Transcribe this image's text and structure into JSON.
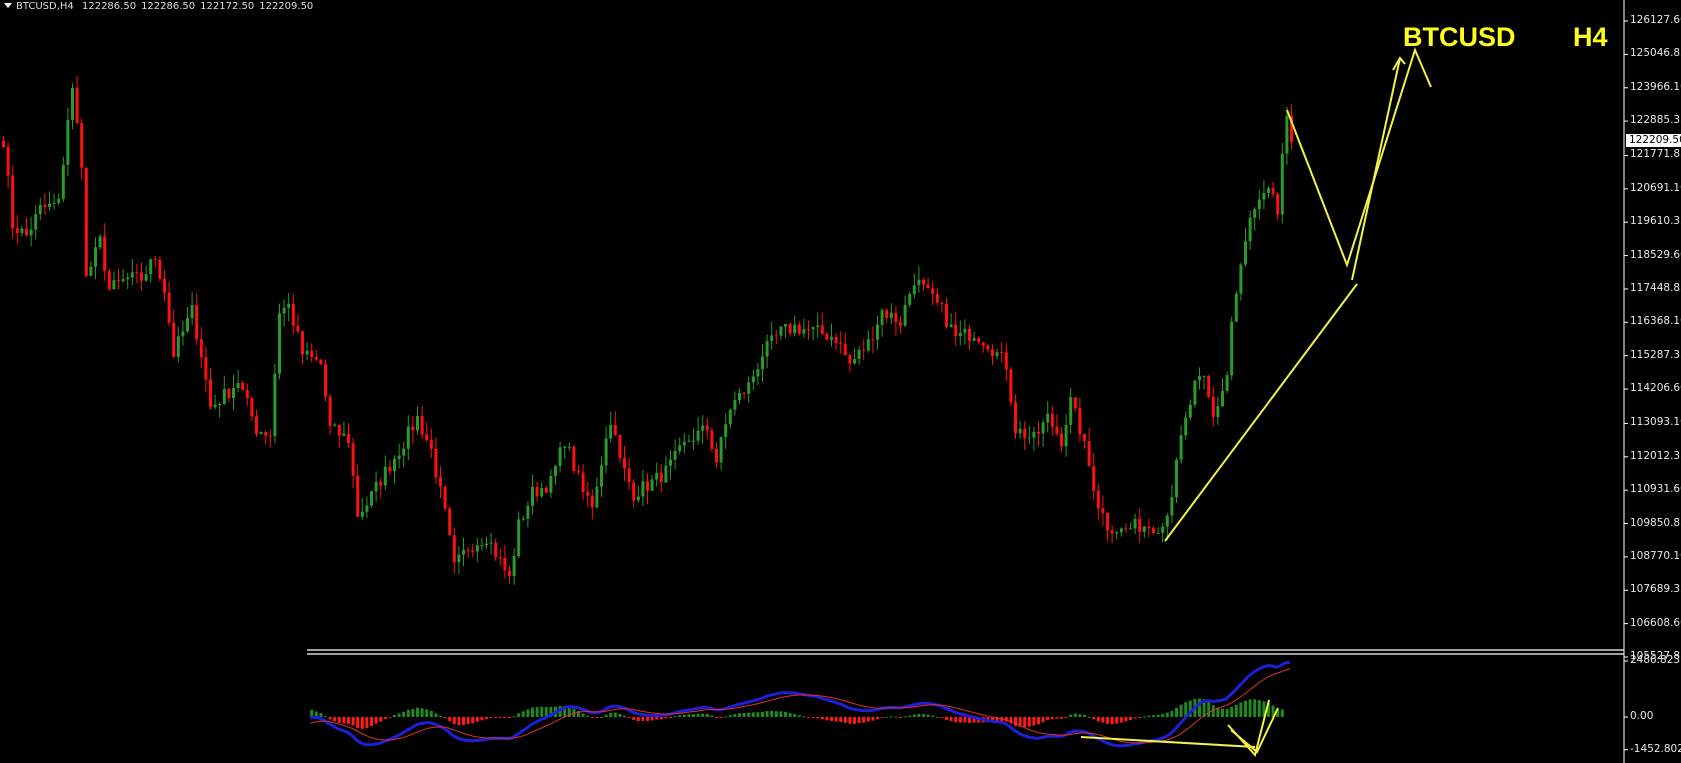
{
  "header": {
    "symbol_tf": "BTCUSD,H4",
    "open": "122286.50",
    "high": "122286.50",
    "low": "122172.50",
    "close": "122209.50"
  },
  "overlay_title": {
    "symbol": "BTCUSD",
    "timeframe": "H4"
  },
  "colors": {
    "bull": "#2a9a2a",
    "bear": "#ff1010",
    "annotation": "#f2f24a",
    "macd": "#1f1fd8",
    "signal": "#e03030",
    "background": "#000000"
  },
  "chart_data": {
    "type": "candlestick",
    "title": "BTCUSD H4",
    "price_axis_ticks": [
      "126127.60",
      "125046.85",
      "123966.10",
      "122885.35",
      "121771.85",
      "120691.10",
      "119610.35",
      "118529.60",
      "117448.85",
      "116368.10",
      "115287.35",
      "114206.60",
      "113093.10",
      "112012.35",
      "110931.60",
      "109850.85",
      "108770.10",
      "107689.35",
      "106608.60",
      "105527.85"
    ],
    "price_range": [
      105527.85,
      126127.6
    ],
    "current_price": "122209.50",
    "close_path": [
      [
        0,
        122294
      ],
      [
        2,
        119516
      ],
      [
        5,
        119169
      ],
      [
        8,
        120037
      ],
      [
        12,
        120210
      ],
      [
        14,
        122988
      ],
      [
        15,
        123856
      ],
      [
        17,
        121600
      ],
      [
        18,
        117781
      ],
      [
        21,
        118996
      ],
      [
        23,
        117434
      ],
      [
        27,
        117781
      ],
      [
        30,
        117781
      ],
      [
        33,
        118475
      ],
      [
        35,
        117434
      ],
      [
        37,
        115350
      ],
      [
        41,
        116739
      ],
      [
        43,
        115350
      ],
      [
        45,
        113614
      ],
      [
        49,
        114135
      ],
      [
        51,
        114482
      ],
      [
        55,
        112920
      ],
      [
        58,
        112746
      ],
      [
        60,
        116739
      ],
      [
        62,
        116912
      ],
      [
        65,
        115350
      ],
      [
        69,
        115003
      ],
      [
        71,
        112920
      ],
      [
        75,
        112572
      ],
      [
        77,
        110142
      ],
      [
        79,
        110489
      ],
      [
        83,
        111531
      ],
      [
        86,
        112225
      ],
      [
        90,
        113267
      ],
      [
        93,
        112225
      ],
      [
        96,
        110142
      ],
      [
        98,
        108406
      ],
      [
        101,
        109101
      ],
      [
        105,
        109448
      ],
      [
        110,
        108059
      ],
      [
        112,
        109795
      ],
      [
        115,
        110836
      ],
      [
        119,
        111183
      ],
      [
        122,
        112572
      ],
      [
        126,
        110836
      ],
      [
        128,
        110489
      ],
      [
        132,
        113267
      ],
      [
        134,
        111878
      ],
      [
        137,
        110836
      ],
      [
        141,
        111183
      ],
      [
        144,
        111531
      ],
      [
        149,
        112572
      ],
      [
        153,
        112920
      ],
      [
        155,
        111878
      ],
      [
        158,
        113614
      ],
      [
        162,
        114309
      ],
      [
        165,
        115350
      ],
      [
        169,
        116044
      ],
      [
        172,
        116218
      ],
      [
        177,
        116044
      ],
      [
        181,
        115871
      ],
      [
        184,
        115003
      ],
      [
        188,
        115697
      ],
      [
        191,
        116739
      ],
      [
        195,
        116392
      ],
      [
        198,
        117781
      ],
      [
        200,
        117434
      ],
      [
        204,
        116739
      ],
      [
        207,
        115871
      ],
      [
        211,
        116044
      ],
      [
        214,
        115697
      ],
      [
        218,
        115003
      ],
      [
        220,
        112920
      ],
      [
        224,
        112572
      ],
      [
        227,
        113267
      ],
      [
        230,
        112572
      ],
      [
        232,
        113788
      ],
      [
        234,
        112920
      ],
      [
        238,
        110489
      ],
      [
        240,
        109795
      ],
      [
        243,
        109621
      ],
      [
        247,
        109795
      ],
      [
        252,
        109795
      ],
      [
        254,
        110836
      ],
      [
        256,
        112572
      ],
      [
        259,
        114309
      ],
      [
        261,
        114482
      ],
      [
        263,
        113267
      ],
      [
        266,
        114655
      ],
      [
        267,
        116392
      ],
      [
        269,
        118127
      ],
      [
        271,
        119690
      ],
      [
        274,
        120384
      ],
      [
        276,
        120558
      ],
      [
        277,
        119864
      ],
      [
        278,
        121600
      ],
      [
        279,
        122815
      ],
      [
        280,
        122209.5
      ]
    ],
    "indicator": {
      "name": "MACD",
      "axis_ticks": [
        "2486.823",
        "0.00",
        "-1452.802"
      ],
      "range": [
        -1452.802,
        2486.823
      ]
    }
  }
}
